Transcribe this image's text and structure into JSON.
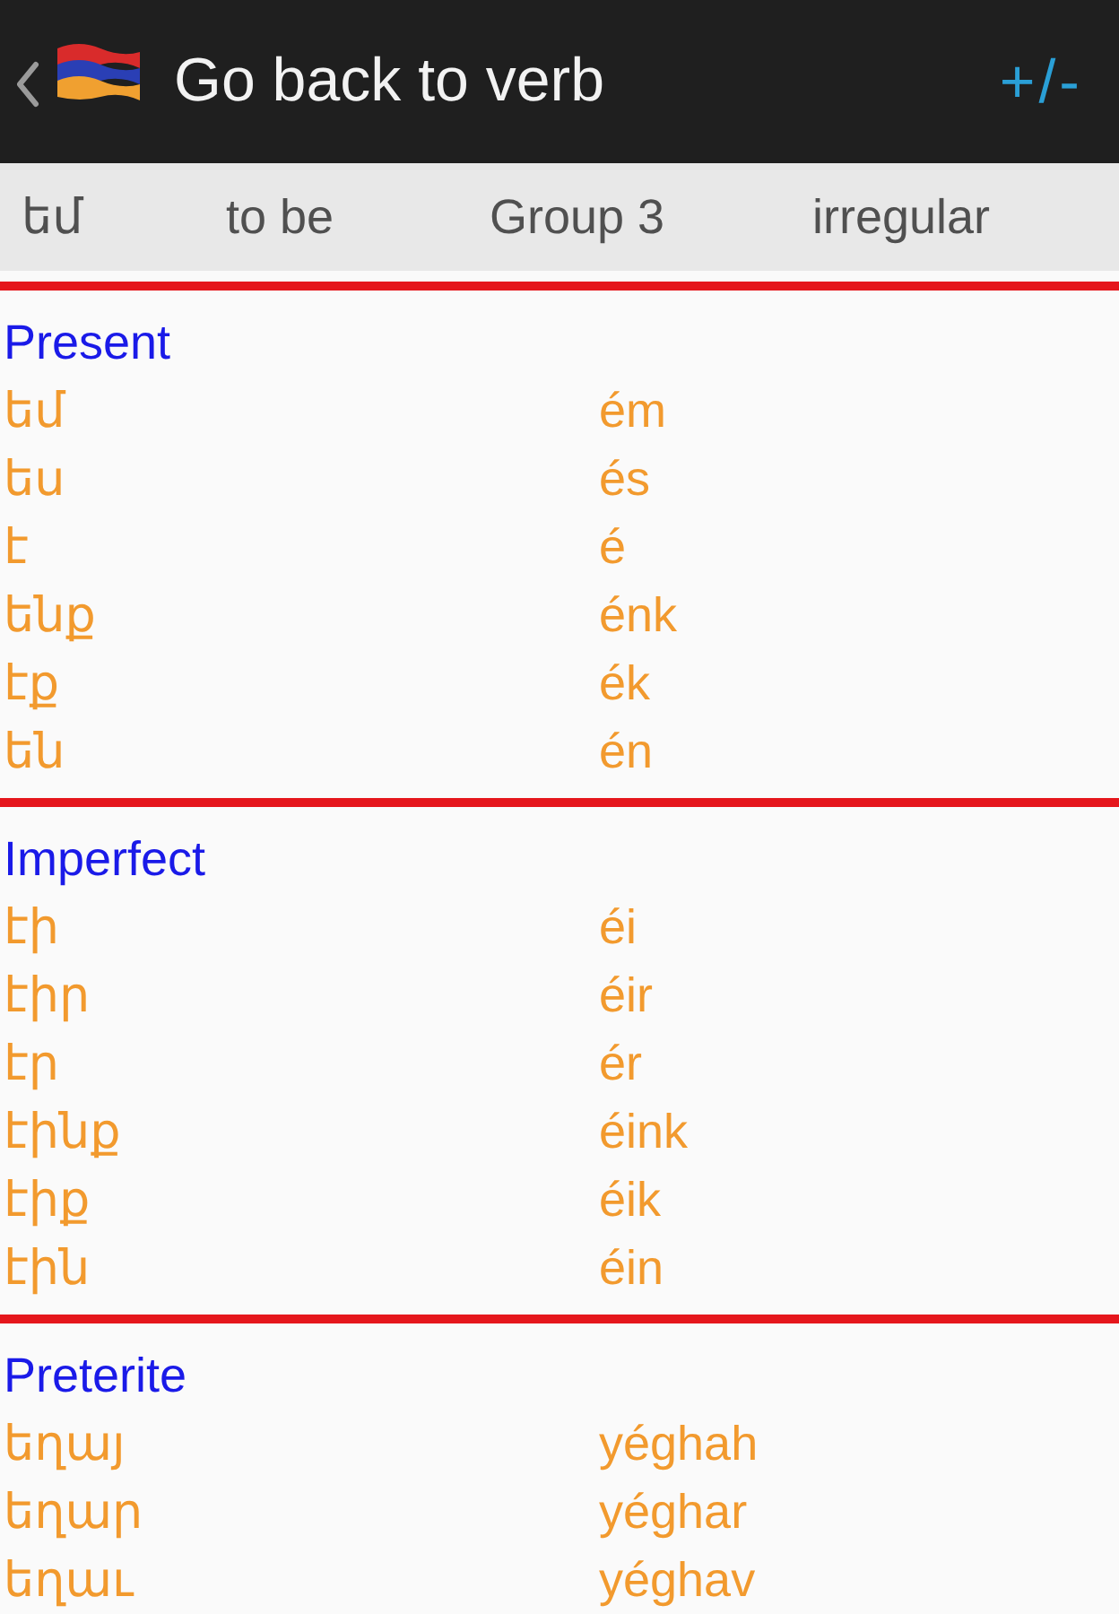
{
  "action_bar": {
    "title": "Go back to verb",
    "action": "+/-"
  },
  "verb_info": [
    "եմ",
    "to be",
    "Group 3",
    "irregular"
  ],
  "tenses": [
    {
      "name": "Present",
      "forms": [
        {
          "armenian": "եմ",
          "transliteration": "ém"
        },
        {
          "armenian": "ես",
          "transliteration": "és"
        },
        {
          "armenian": "է",
          "transliteration": "é"
        },
        {
          "armenian": "ենք",
          "transliteration": "énk"
        },
        {
          "armenian": "էք",
          "transliteration": "ék"
        },
        {
          "armenian": "են",
          "transliteration": "én"
        }
      ]
    },
    {
      "name": "Imperfect",
      "forms": [
        {
          "armenian": "էի",
          "transliteration": "éi"
        },
        {
          "armenian": "էիր",
          "transliteration": "éir"
        },
        {
          "armenian": "էր",
          "transliteration": "ér"
        },
        {
          "armenian": "էինք",
          "transliteration": "éink"
        },
        {
          "armenian": "էիք",
          "transliteration": "éik"
        },
        {
          "armenian": "էին",
          "transliteration": "éin"
        }
      ]
    },
    {
      "name": "Preterite",
      "forms": [
        {
          "armenian": "եղայ",
          "transliteration": "yéghah"
        },
        {
          "armenian": "եղար",
          "transliteration": "yéghar"
        },
        {
          "armenian": "եղաւ",
          "transliteration": "yéghav"
        }
      ]
    }
  ]
}
